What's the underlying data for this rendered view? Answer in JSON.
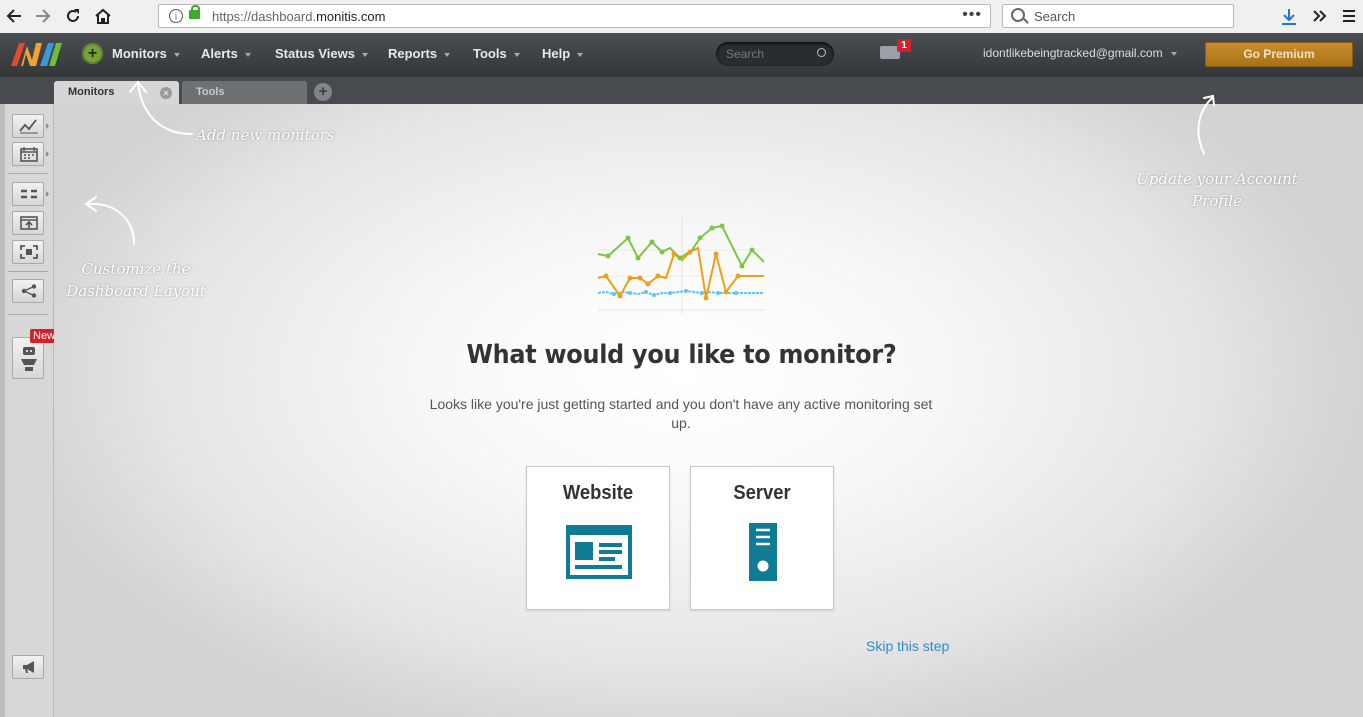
{
  "browser": {
    "url_prefix": "https://dashboard.",
    "url_domain": "monitis.com",
    "search_placeholder": "Search"
  },
  "header": {
    "menu": [
      {
        "label": "Monitors"
      },
      {
        "label": "Alerts"
      },
      {
        "label": "Status Views"
      },
      {
        "label": "Reports"
      },
      {
        "label": "Tools"
      },
      {
        "label": "Help"
      }
    ],
    "search_placeholder": "Search",
    "notification_count": "1",
    "account_email": "idontlikebeingtracked@gmail.com",
    "premium_label": "Go Premium"
  },
  "tabs": [
    {
      "label": "Monitors",
      "active": true
    },
    {
      "label": "Tools",
      "active": false
    }
  ],
  "sidebar": {
    "new_badge": "New",
    "icons": [
      "graph-icon",
      "calendar-icon",
      "layout-icon",
      "add-widget-icon",
      "fullscreen-icon",
      "share-icon",
      "robot-icon",
      "megaphone-icon"
    ]
  },
  "hints": {
    "add_monitors": "Add new monitors",
    "customize_line1": "Customize the",
    "customize_line2": "Dashboard Layout",
    "account_line1": "Update your Account",
    "account_line2": "Profile"
  },
  "main": {
    "headline": "What would you like to monitor?",
    "subtext": "Looks like you're just getting started and you don't have any active monitoring set up.",
    "options": [
      {
        "label": "Website",
        "icon": "website-icon"
      },
      {
        "label": "Server",
        "icon": "server-icon"
      }
    ],
    "skip_label": "Skip this step"
  },
  "colors": {
    "accent_teal": "#0f7b95",
    "premium": "#b87d22",
    "link": "#2f8bc7",
    "badge_red": "#d2232a",
    "monitors_green": "#74a33a"
  }
}
